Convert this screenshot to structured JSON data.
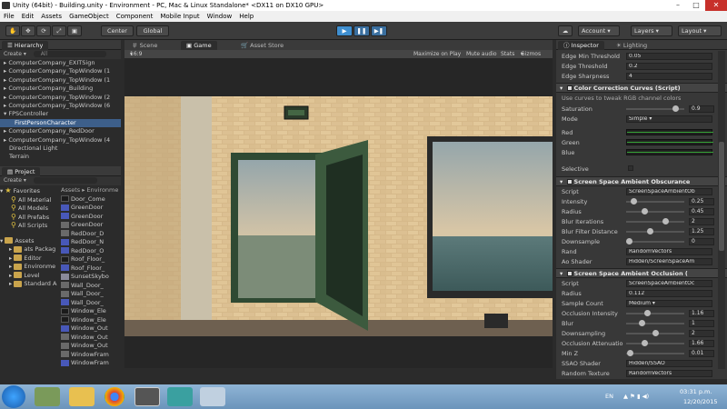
{
  "window": {
    "title": "Unity (64bit) - Building.unity - Environment - PC, Mac & Linux Standalone* <DX11 on DX10 GPU>"
  },
  "menu": [
    "File",
    "Edit",
    "Assets",
    "GameObject",
    "Component",
    "Mobile Input",
    "Window",
    "Help"
  ],
  "toolbar": {
    "pivot": "Center",
    "space": "Global",
    "account": "Account",
    "layers": "Layers",
    "layout": "Layout"
  },
  "hierarchy": {
    "tab": "Hierarchy",
    "create": "Create",
    "search": "All",
    "items": [
      {
        "label": "ComputerCompany_EXITSign",
        "selected": false
      },
      {
        "label": "ComputerCompany_TopWindow (1",
        "selected": false
      },
      {
        "label": "ComputerCompany_TopWindow (1",
        "selected": false
      },
      {
        "label": "ComputerCompany_Building",
        "selected": false
      },
      {
        "label": "ComputerCompany_TopWindow (2",
        "selected": false
      },
      {
        "label": "ComputerCompany_TopWindow (6",
        "selected": false
      },
      {
        "label": "FPSController",
        "selected": false
      },
      {
        "label": "FirstPersonCharacter",
        "selected": true
      },
      {
        "label": "ComputerCompany_RedDoor",
        "selected": false
      },
      {
        "label": "ComputerCompany_TopWindow (4",
        "selected": false
      },
      {
        "label": "Directional Light",
        "selected": false
      },
      {
        "label": "Terrain",
        "selected": false
      }
    ]
  },
  "project": {
    "tab": "Project",
    "create": "Create",
    "favorites_label": "Favorites",
    "favorites": [
      "All Material",
      "All Models",
      "All Prefabs",
      "All Scripts"
    ],
    "assets_label": "Assets",
    "folders": [
      "ats Packag",
      "Editor",
      "Environme",
      "Level",
      "Standard A"
    ],
    "breadcrumb": "Assets ▸ Environme",
    "files": [
      {
        "label": "Door_Come",
        "type": "dark"
      },
      {
        "label": "GreenDoor",
        "type": "blue"
      },
      {
        "label": "GreenDoor",
        "type": "blue"
      },
      {
        "label": "GreenDoor",
        "type": "grey"
      },
      {
        "label": "RedDoor_D",
        "type": "grey"
      },
      {
        "label": "RedDoor_N",
        "type": "blue"
      },
      {
        "label": "RedDoor_O",
        "type": "blue"
      },
      {
        "label": "Roof_Floor_",
        "type": "dark"
      },
      {
        "label": "Roof_Floor_",
        "type": "blue"
      },
      {
        "label": "SunsetSkybo",
        "type": "mat"
      },
      {
        "label": "Wall_Door_",
        "type": "grey"
      },
      {
        "label": "Wall_Door_",
        "type": "grey"
      },
      {
        "label": "Wall_Door_",
        "type": "blue"
      },
      {
        "label": "Window_Ele",
        "type": "dark"
      },
      {
        "label": "Window_Ele",
        "type": "dark"
      },
      {
        "label": "Window_Out",
        "type": "blue"
      },
      {
        "label": "Window_Out",
        "type": "grey"
      },
      {
        "label": "Window_Out",
        "type": "grey"
      },
      {
        "label": "WindowFram",
        "type": "grey"
      },
      {
        "label": "WindowFram",
        "type": "blue"
      }
    ]
  },
  "view": {
    "tabs": [
      "Scene",
      "Game",
      "Asset Store"
    ],
    "aspect": "16:9",
    "options": [
      "Maximize on Play",
      "Mute audio",
      "Stats",
      "Gizmos"
    ]
  },
  "inspector": {
    "tabs": [
      "Inspector",
      "Lighting"
    ],
    "top_rows": [
      {
        "label": "Edge Min Threshold",
        "value": "0.05"
      },
      {
        "label": "Edge Threshold",
        "value": "0.2"
      },
      {
        "label": "Edge Sharpness",
        "value": "4"
      }
    ],
    "color_correction": {
      "title": "Color Correction Curves (Script)",
      "desc": "Use curves to tweak RGB channel colors",
      "saturation_label": "Saturation",
      "saturation": "0.9",
      "saturation_fraction": 0.9,
      "mode_label": "Mode",
      "mode": "Simple",
      "channels": [
        "Red",
        "Green",
        "Blue"
      ],
      "selective_label": "Selective"
    },
    "ssao_obscurance": {
      "title": "Screen Space Ambient Obscurance",
      "script_label": "Script",
      "script": "ScreenSpaceAmbientOb",
      "sliders": [
        {
          "label": "Intensity",
          "value": "0.25",
          "fraction": 0.08
        },
        {
          "label": "Radius",
          "value": "0.45",
          "fraction": 0.3
        },
        {
          "label": "Blur Iterations",
          "value": "2",
          "fraction": 0.7
        },
        {
          "label": "Blur Filter Distance",
          "value": "1.25",
          "fraction": 0.4
        },
        {
          "label": "Downsample",
          "value": "0",
          "fraction": 0.0
        }
      ],
      "rand_label": "Rand",
      "rand": "RandomVectors",
      "ao_shader_label": "Ao Shader",
      "ao_shader": "Hidden/ScreenSpaceAm"
    },
    "ssao": {
      "title": "Screen Space Ambient Occlusion (",
      "script_label": "Script",
      "script": "ScreenSpaceAmbientOc",
      "radius_label": "Radius",
      "radius": "0.112",
      "sample_label": "Sample Count",
      "sample": "Medium",
      "sliders": [
        {
          "label": "Occlusion Intensity",
          "value": "1.16",
          "fraction": 0.35
        },
        {
          "label": "Blur",
          "value": "1",
          "fraction": 0.25
        },
        {
          "label": "Downsampling",
          "value": "2",
          "fraction": 0.5
        },
        {
          "label": "Occlusion Attenuatio",
          "value": "1.66",
          "fraction": 0.3
        },
        {
          "label": "Min Z",
          "value": "0.01",
          "fraction": 0.02
        }
      ],
      "shader_label": "SSAO Shader",
      "shader": "Hidden/SSAO",
      "texture_label": "Random Texture",
      "texture": "RandomVectors"
    }
  },
  "taskbar": {
    "lang": "EN",
    "time": "03:31",
    "ampm": "p.m.",
    "date": "12/20/2015"
  }
}
